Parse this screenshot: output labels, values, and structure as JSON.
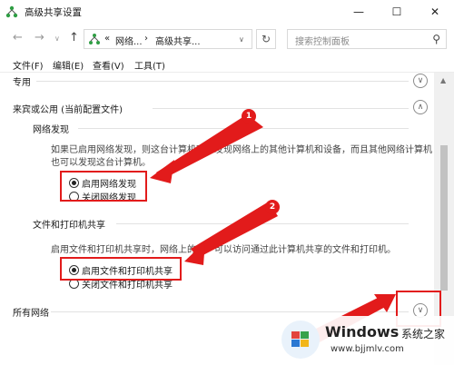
{
  "window": {
    "title": "高级共享设置",
    "icon": "network-icon",
    "controls": [
      "minimize",
      "maximize",
      "close"
    ]
  },
  "nav": {
    "back_icon": "arrow-left-icon",
    "forward_icon": "arrow-right-icon",
    "recent_icon": "chevron-down-icon",
    "up_icon": "arrow-up-icon",
    "address": {
      "prefix": "«",
      "crumb1": "网络...",
      "separator": "›",
      "crumb2": "高级共享...",
      "dropdown_icon": "chevron-down-icon"
    },
    "refresh_icon": "refresh-icon",
    "search_placeholder": "搜索控制面板",
    "search_icon": "search-icon"
  },
  "menu": {
    "file": "文件(F)",
    "edit": "编辑(E)",
    "view": "查看(V)",
    "tools": "工具(T)"
  },
  "sections": {
    "private": {
      "title": "专用",
      "state": "collapsed"
    },
    "guest_public": {
      "title": "来宾或公用 (当前配置文件)",
      "state": "expanded",
      "network_discovery": {
        "title": "网络发现",
        "description_line1": "如果已启用网络发现，则这台计算机可以发现网络上的其他计算机和设备，而且其他网络计算机",
        "description_line2": "也可以发现这台计算机。",
        "option_on": "启用网络发现",
        "option_off": "关闭网络发现",
        "selected": "on"
      },
      "file_printer_sharing": {
        "title": "文件和打印机共享",
        "description": "启用文件和打印机共享时，网络上的用户可以访问通过此计算机共享的文件和打印机。",
        "option_on": "启用文件和打印机共享",
        "option_off": "关闭文件和打印机共享",
        "selected": "on"
      }
    },
    "all_networks": {
      "title": "所有网络",
      "state": "collapsed"
    }
  },
  "annotations": {
    "marker1": "1",
    "marker2": "2",
    "color": "#e21b1b"
  },
  "watermark": {
    "brand": "Windows",
    "brand_cn": "系统之家",
    "url": "www.bjjmlv.com"
  }
}
